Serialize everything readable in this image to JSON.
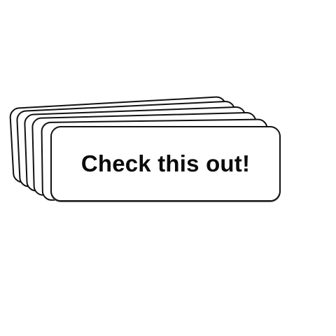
{
  "sticker": {
    "text": "Check this out!",
    "stack_count": 6,
    "colors": {
      "background": "#ffffff",
      "card_fill": "#ffffff",
      "card_border": "#111111",
      "text": "#0b0b0b"
    }
  }
}
